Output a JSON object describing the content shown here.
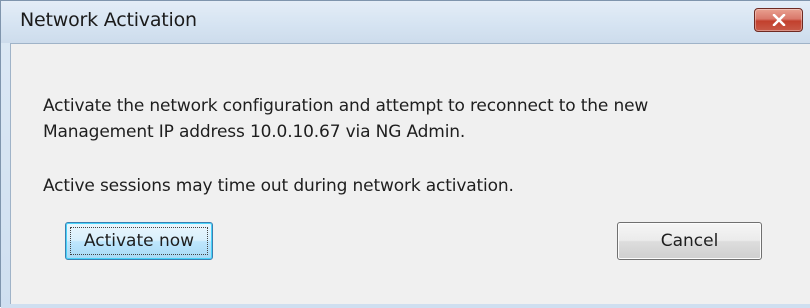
{
  "window": {
    "title": "Network Activation",
    "close_icon": "close-icon",
    "close_color": "#c7432f"
  },
  "message": {
    "line1": "Activate the network configuration and attempt to reconnect to the new",
    "line2": "Management IP address 10.0.10.67 via NG Admin.",
    "line3": "Active sessions may time out during network activation."
  },
  "buttons": {
    "activate_label": "Activate now",
    "cancel_label": "Cancel"
  }
}
